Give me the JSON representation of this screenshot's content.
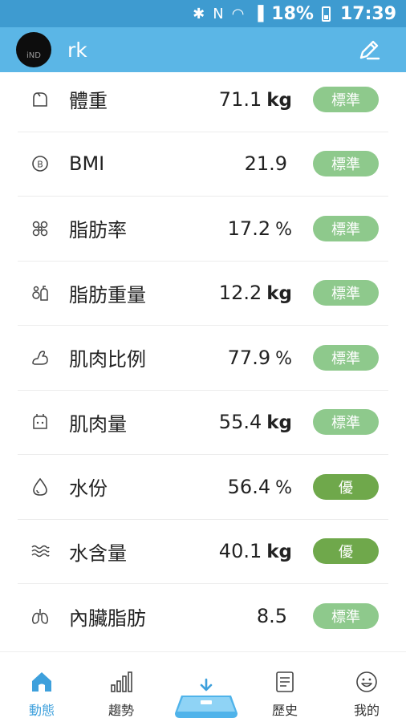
{
  "status_bar": {
    "battery": "18%",
    "time": "17:39"
  },
  "header": {
    "username": "rk",
    "avatar_text": "iND"
  },
  "metrics": [
    {
      "icon": "weight-icon",
      "label": "體重",
      "value": "71.1",
      "unit": "kg",
      "status": "標準",
      "status_color": "#8ec98c"
    },
    {
      "icon": "bmi-icon",
      "label": "BMI",
      "value": "21.9",
      "unit": "",
      "status": "標準",
      "status_color": "#8ec98c"
    },
    {
      "icon": "body-fat-icon",
      "label": "脂肪率",
      "value": "17.2",
      "unit": "%",
      "status": "標準",
      "status_color": "#8ec98c"
    },
    {
      "icon": "fat-mass-icon",
      "label": "脂肪重量",
      "value": "12.2",
      "unit": "kg",
      "status": "標準",
      "status_color": "#8ec98c"
    },
    {
      "icon": "muscle-icon",
      "label": "肌肉比例",
      "value": "77.9",
      "unit": "%",
      "status": "標準",
      "status_color": "#8ec98c"
    },
    {
      "icon": "muscle-mass-icon",
      "label": "肌肉量",
      "value": "55.4",
      "unit": "kg",
      "status": "標準",
      "status_color": "#8ec98c"
    },
    {
      "icon": "water-drop-icon",
      "label": "水份",
      "value": "56.4",
      "unit": "%",
      "status": "優",
      "status_color": "#6fa84b"
    },
    {
      "icon": "water-waves-icon",
      "label": "水含量",
      "value": "40.1",
      "unit": "kg",
      "status": "優",
      "status_color": "#6fa84b"
    },
    {
      "icon": "lungs-icon",
      "label": "內臟脂肪",
      "value": "8.5",
      "unit": "",
      "status": "標準",
      "status_color": "#8ec98c"
    }
  ],
  "bottom_nav": [
    {
      "label": "動態",
      "icon": "home-icon",
      "active": true
    },
    {
      "label": "趨勢",
      "icon": "bar-chart-icon",
      "active": false
    },
    {
      "label": "歷史",
      "icon": "document-icon",
      "active": false
    },
    {
      "label": "我的",
      "icon": "smiley-icon",
      "active": false
    }
  ],
  "colors": {
    "status_bar": "#3e9bd0",
    "header": "#5bb6e6",
    "accent": "#3ea0dc",
    "badge_standard": "#8ec98c",
    "badge_excellent": "#6fa84b"
  }
}
